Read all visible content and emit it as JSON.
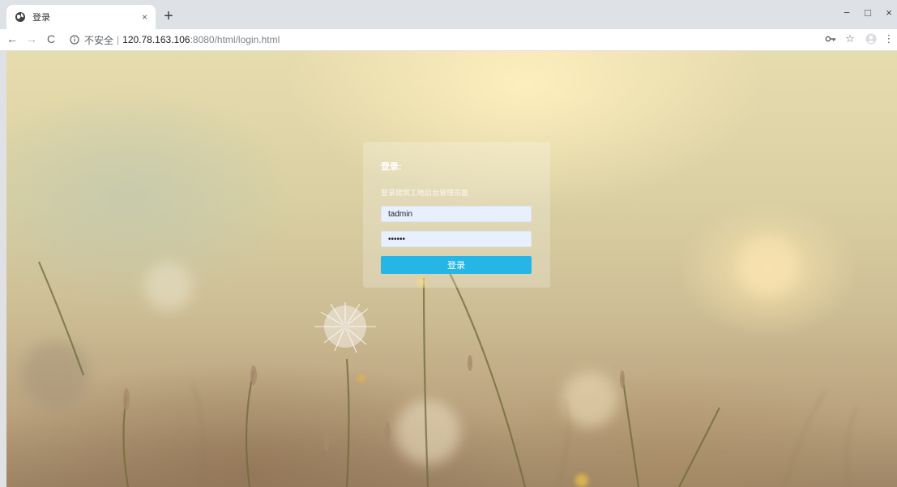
{
  "browser": {
    "tab_title": "登录",
    "tab_close": "×",
    "new_tab": "+",
    "window_controls": {
      "minimize": "−",
      "maximize": "□",
      "close": "×"
    },
    "nav": {
      "back": "←",
      "forward": "→",
      "reload": "C"
    },
    "address": {
      "security_label": "不安全",
      "separator": "|",
      "host": "120.78.163.106",
      "rest": ":8080/html/login.html"
    },
    "toolbar_icons": [
      "key-icon",
      "star-icon",
      "profile-icon",
      "menu-icon"
    ]
  },
  "login": {
    "title": "登录:",
    "subtitle": "登录建筑工地后台管理员面",
    "username_value": "tadmin",
    "password_value": "••••••",
    "submit_label": "登录"
  },
  "colors": {
    "button": "#25b6e6",
    "field_bg": "#e8f0fe",
    "card_bg": "rgba(255,255,255,0.22)"
  }
}
